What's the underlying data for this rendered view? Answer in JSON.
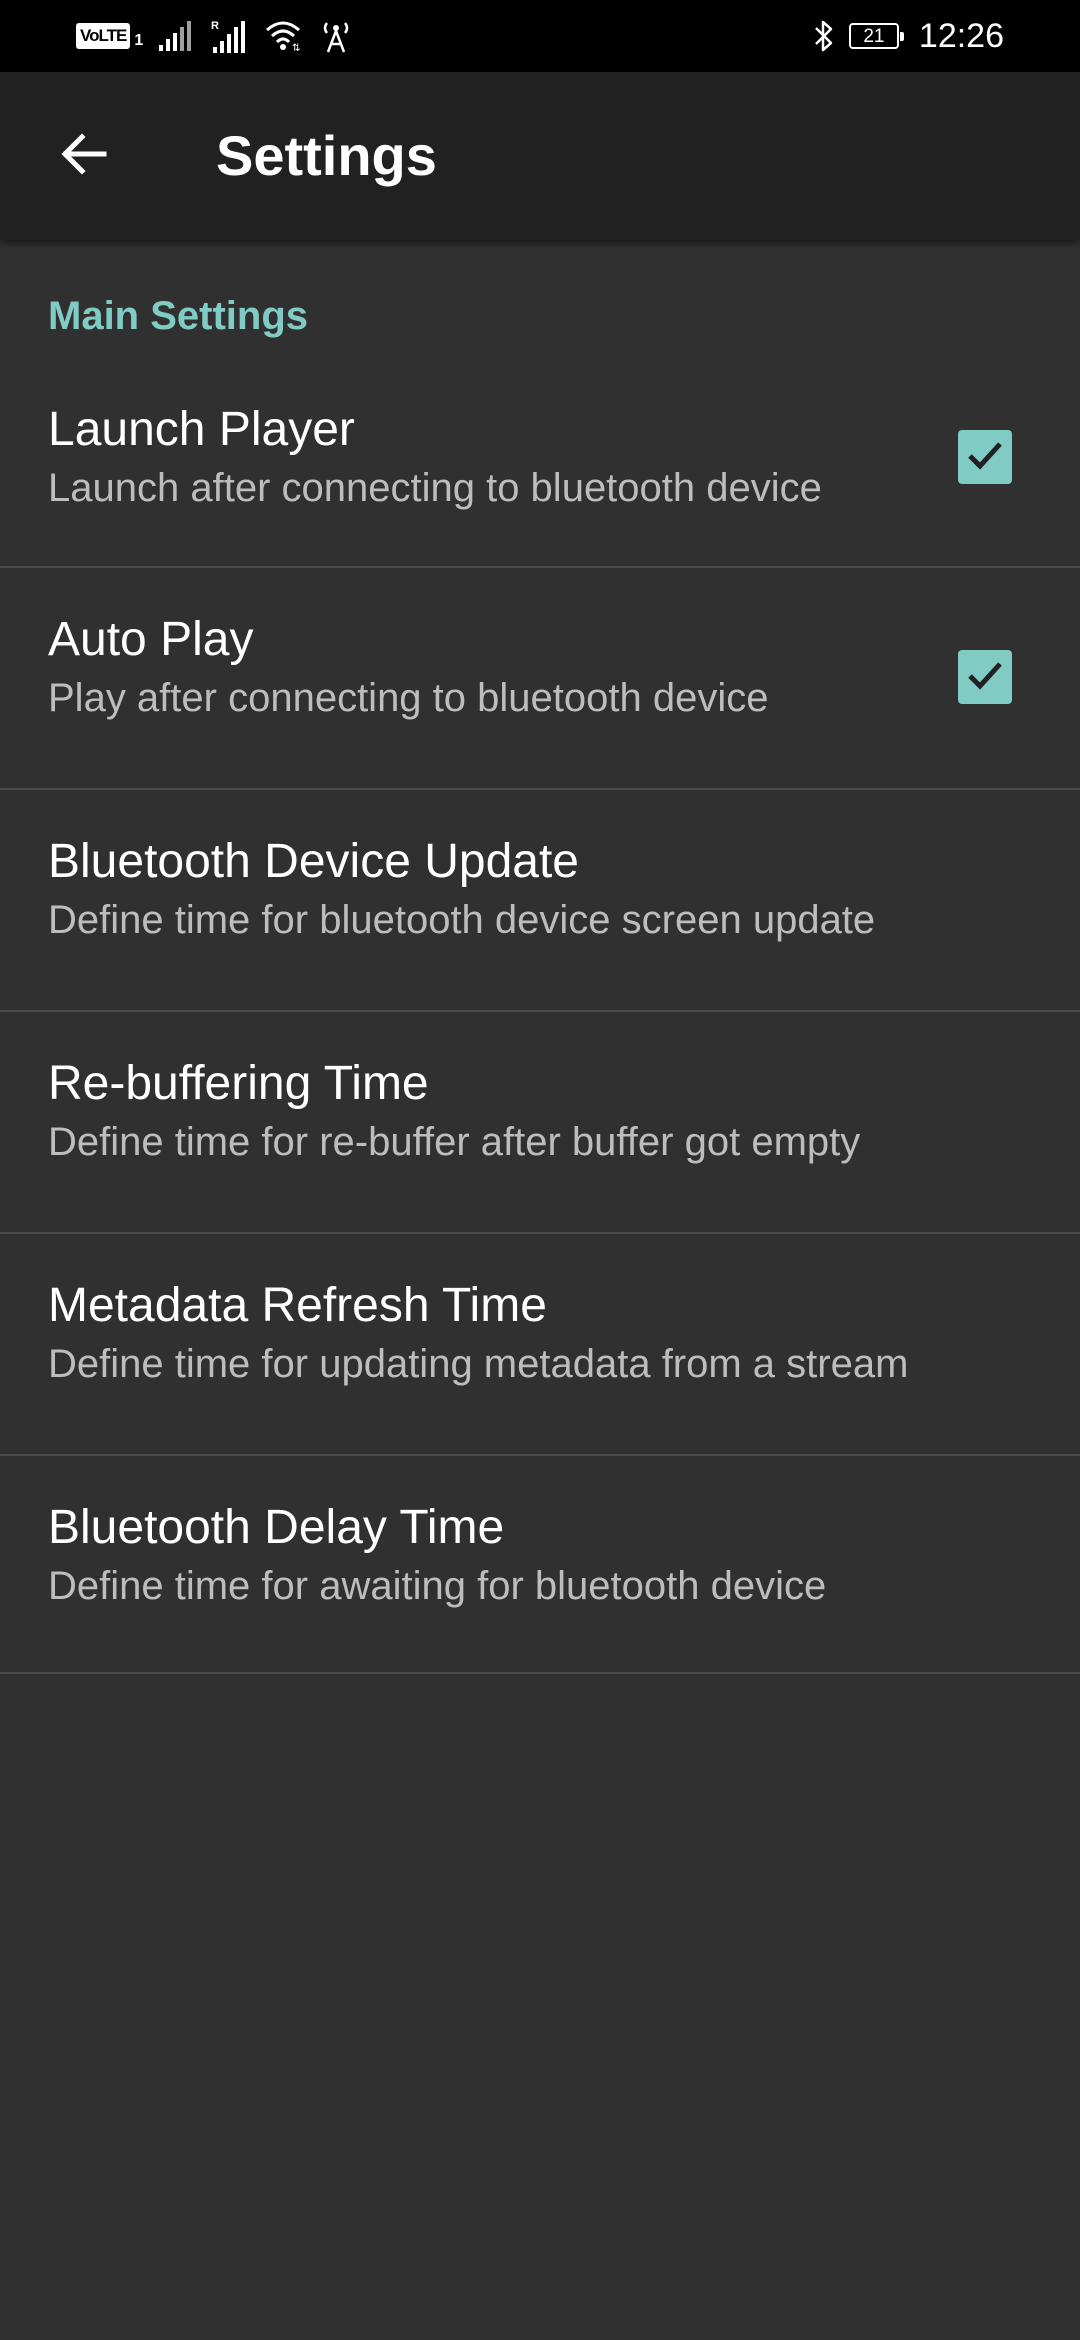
{
  "status_bar": {
    "volte": "VoLTE",
    "sim": "1",
    "battery": "21",
    "time": "12:26",
    "icons": [
      "signal-icon",
      "signal-roaming-icon",
      "wifi-icon",
      "hotspot-icon",
      "bluetooth-icon",
      "battery-icon"
    ]
  },
  "app_bar": {
    "back_icon": "arrow-left-icon",
    "title": "Settings"
  },
  "section": {
    "header": "Main Settings"
  },
  "preferences": [
    {
      "title": "Launch Player",
      "summary": "Launch after connecting to bluetooth device",
      "checkbox": true,
      "checked": true
    },
    {
      "title": "Auto Play",
      "summary": "Play after connecting to bluetooth device",
      "checkbox": true,
      "checked": true
    },
    {
      "title": "Bluetooth Device Update",
      "summary": "Define time for bluetooth device screen update"
    },
    {
      "title": "Re-buffering Time",
      "summary": "Define time for re-buffer after buffer got empty"
    },
    {
      "title": "Metadata Refresh Time",
      "summary": "Define time for updating metadata from a stream"
    },
    {
      "title": "Bluetooth Delay Time",
      "summary": "Define time for awaiting for bluetooth device"
    }
  ],
  "colors": {
    "accent": "#80cbc4",
    "background": "#303030",
    "app_bar": "#212121",
    "status_bar": "#000000",
    "divider": "#4a4a4a",
    "secondary_text": "#bdbdbd"
  }
}
